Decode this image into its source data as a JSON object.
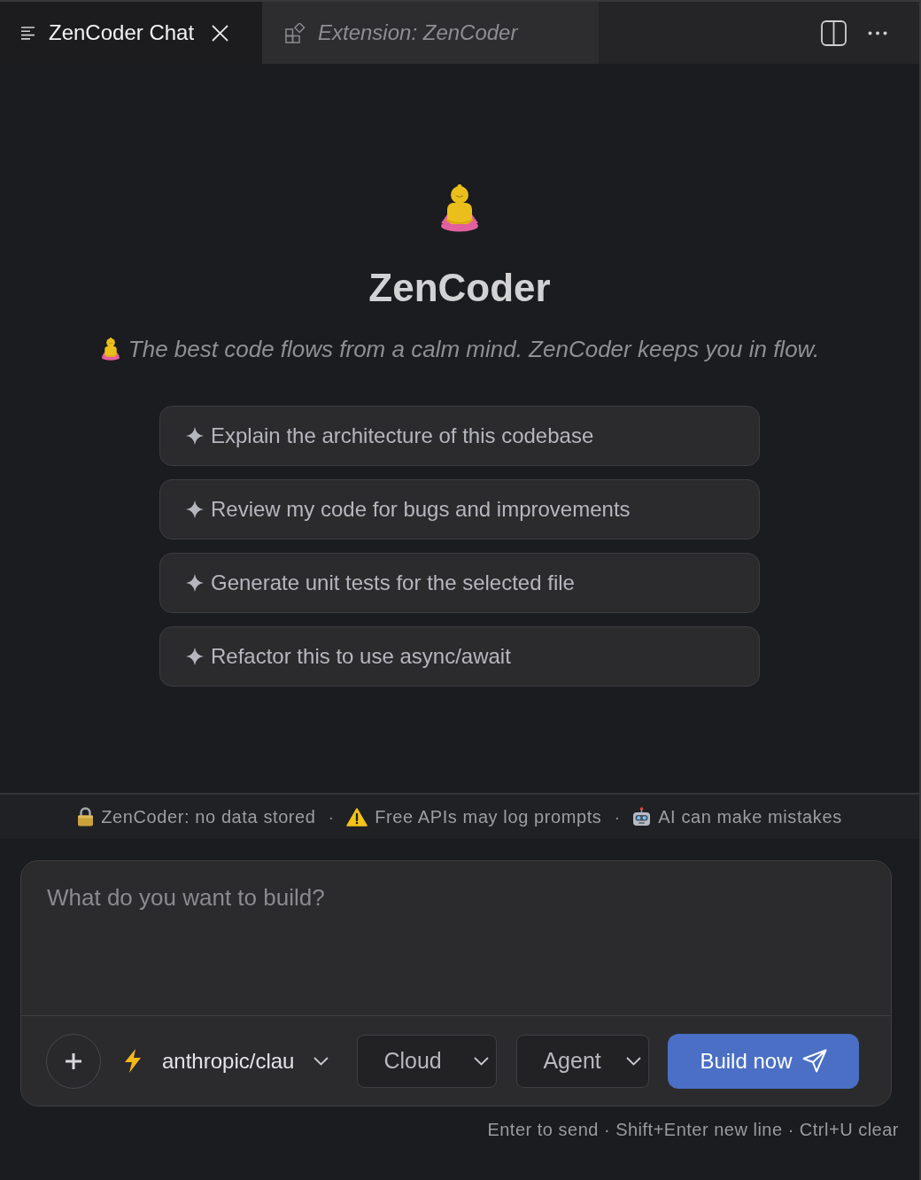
{
  "tabs": [
    {
      "label": "ZenCoder Chat",
      "kind": "chat",
      "selected": true,
      "preview": false
    },
    {
      "label": "Extension: ZenCoder",
      "kind": "extension",
      "selected": false,
      "preview": true
    }
  ],
  "hero": {
    "title": "ZenCoder",
    "tagline": "The best code flows from a calm mind. ZenCoder keeps you in flow."
  },
  "suggestions": [
    "Explain the architecture of this codebase",
    "Review my code for bugs and improvements",
    "Generate unit tests for the selected file",
    "Refactor this to use async/await"
  ],
  "notices": {
    "separator": "·",
    "items": [
      {
        "kind": "lock",
        "text": "ZenCoder: no data stored"
      },
      {
        "kind": "warning",
        "text": "Free APIs may log prompts"
      },
      {
        "kind": "robot",
        "text": "AI can make mistakes"
      }
    ]
  },
  "composer": {
    "placeholder": "What do you want to build?",
    "model": "anthropic/clau",
    "dropdowns": [
      {
        "value": "Cloud"
      },
      {
        "value": "Agent"
      }
    ],
    "submit": "Build now"
  },
  "hint": "Enter to send · Shift+Enter new line · Ctrl+U clear"
}
